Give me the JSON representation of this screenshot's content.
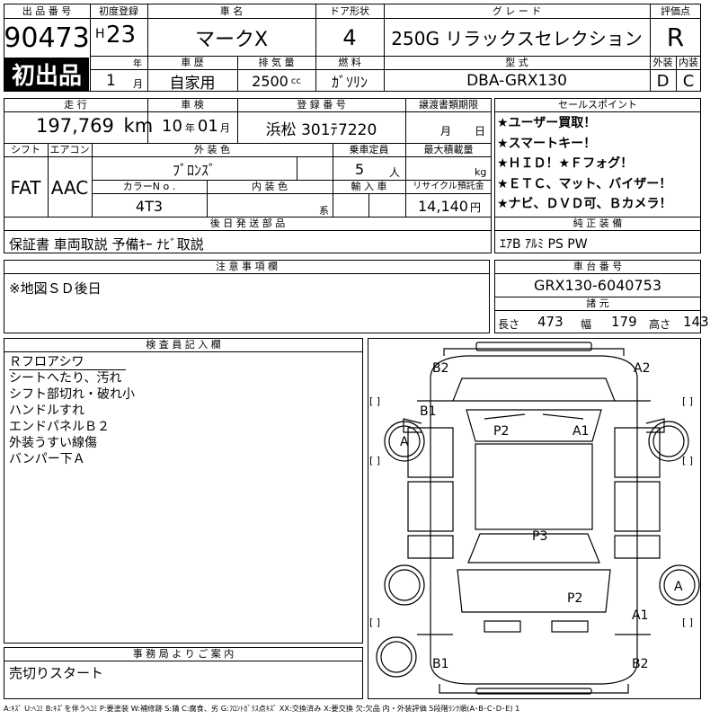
{
  "lot": {
    "label": "出 品 番 号",
    "number": "90473",
    "badge": "初出品"
  },
  "first_reg": {
    "label": "初度登録",
    "era": "H",
    "year": "23",
    "year_unit": "年",
    "month": "1",
    "month_unit": "月"
  },
  "car_name": {
    "label": "車 名",
    "value": "マークX"
  },
  "door": {
    "label": "ドア形状",
    "value": "4"
  },
  "grade": {
    "label": "グ レ ー ド",
    "value": "250G リラックスセレクション"
  },
  "score": {
    "label": "評価点",
    "value": "R"
  },
  "history": {
    "label": "車 歴",
    "value": "自家用"
  },
  "displacement": {
    "label": "排 気 量",
    "value": "2500",
    "unit": "cc"
  },
  "fuel": {
    "label": "燃 料",
    "value": "ｶﾞｿﾘﾝ"
  },
  "model_code": {
    "label": "型 式",
    "value": "DBA-GRX130"
  },
  "exterior_grade": {
    "label": "外装",
    "value": "D"
  },
  "interior_grade": {
    "label": "内装",
    "value": "C"
  },
  "mileage": {
    "label": "走 行",
    "value": "197,769",
    "unit": "km"
  },
  "inspection": {
    "label": "車 検",
    "year": "10",
    "year_unit": "年",
    "month": "01",
    "month_unit": "月"
  },
  "registration": {
    "label": "登 録 番 号",
    "value": "浜松 301ﾃ7220"
  },
  "transfer_due": {
    "label": "譲渡書類期限",
    "month_unit": "月",
    "day_unit": "日"
  },
  "shift": {
    "label": "シフト",
    "value": "FAT"
  },
  "aircon": {
    "label": "エアコン",
    "value": "AAC"
  },
  "ext_color": {
    "label": "外 装 色",
    "value": "ﾌﾞﾛﾝｽﾞ"
  },
  "capacity": {
    "label": "乗車定員",
    "value": "5",
    "unit": "人"
  },
  "max_load": {
    "label": "最大積載量",
    "unit": "kg"
  },
  "color_no": {
    "label": "カラーN o .",
    "value": "4T3"
  },
  "int_color": {
    "label": "内 装 色",
    "unit": "系"
  },
  "import": {
    "label": "輸 入 車"
  },
  "recycle": {
    "label": "リサイクル預託金",
    "value": "14,140",
    "unit": "円"
  },
  "sales_points": {
    "label": "セールスポイント",
    "items": [
      "★ユーザー買取！",
      "★スマートキー！",
      "★ＨＩＤ！★Ｆフォグ！",
      "★ＥＴＣ、マット、バイザー！",
      "★ナビ、ＤＶＤ可、Ｂカメラ！"
    ]
  },
  "later_parts": {
    "label": "後 日 発 送 部 品",
    "value": "保証書 車両取説 予備ｷｰ ﾅﾋﾞ取説"
  },
  "equipment": {
    "label": "純 正 装 備",
    "value": "ｴｱB ｱﾙﾐ PS PW"
  },
  "notes": {
    "label": "注 意 事 項 欄",
    "value": "※地図ＳＤ後日"
  },
  "chassis": {
    "label": "車 台 番 号",
    "value": "GRX130-6040753"
  },
  "dims": {
    "label": "諸 元",
    "length_label": "長さ",
    "length": "473",
    "width_label": "幅",
    "width": "179",
    "height_label": "高さ",
    "height": "143"
  },
  "inspector": {
    "label": "検 査 員 記 入 欄",
    "text": "Ｒフロアシワ\nシートへたり、汚れ\nシフト部切れ・破れ小\nハンドルすれ\nエンドパネルＢ２\n外装うすい線傷\nバンパー下Ａ"
  },
  "office": {
    "label": "事 務 局 よ り ご 案 内",
    "value": "売切りスタート"
  },
  "diagram": {
    "marks": [
      "B2",
      "A2",
      "B1",
      "P2",
      "A1",
      "A",
      "P3",
      "P2",
      "A",
      "A1",
      "B1",
      "B2"
    ],
    "brackets": [
      "[ ]",
      "[ ]",
      "[ ]",
      "[ ]",
      "[ ]",
      "[ ]"
    ]
  },
  "legend": "A:ｷｽﾞ U:ﾍｺﾐ B:ｷｽﾞを伴うﾍｺﾐ P:要塗装 W:補修跡 S:錆 C:腐食、劣 G:ﾌﾛﾝﾄｶﾞﾗｽ点ｷｽﾞ XX:交換済み X:要交換 欠:欠品 内・外装評価 5段階ﾗﾝｸ順(A･B･C･D･E) 1"
}
